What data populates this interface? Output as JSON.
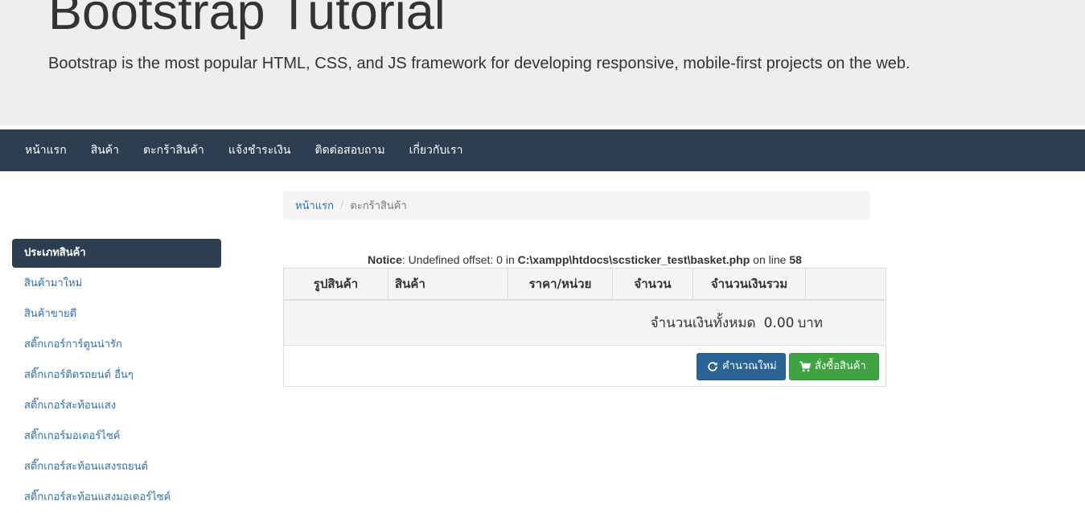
{
  "jumbotron": {
    "title": "Bootstrap Tutorial",
    "lead": "Bootstrap is the most popular HTML, CSS, and JS framework for developing responsive, mobile-first projects on the web."
  },
  "navbar": {
    "items": [
      "หน้าแรก",
      "สินค้า",
      "ตะกร้าสินค้า",
      "แจ้งชำระเงิน",
      "ติดต่อสอบถาม",
      "เกี่ยวกับเรา"
    ]
  },
  "breadcrumb": {
    "home": "หน้าแรก",
    "separator": "/",
    "current": "ตะกร้าสินค้า"
  },
  "sidebar": {
    "header": "ประเภทสินค้า",
    "items": [
      "สินค้ามาใหม่",
      "สินค้าขายดี",
      "สติ๊กเกอร์การ์ตูนน่ารัก",
      "สติ๊กเกอร์ติดรถยนต์ อื่นๆ",
      "สติ๊กเกอร์สะท้อนแสง",
      "สติ๊กเกอร์มอเตอร์ไซค์",
      "สติ๊กเกอร์สะท้อนแสงรถยนต์",
      "สติ๊กเกอร์สะท้อนแสงมอเตอร์ไซค์"
    ]
  },
  "notice": {
    "label": "Notice",
    "message_a": ": Undefined offset: 0 in ",
    "path": "C:\\xampp\\htdocs\\scsticker_test\\basket.php",
    "message_b": " on line ",
    "line": "58"
  },
  "cart": {
    "columns": [
      "รูปสินค้า",
      "สินค้า",
      "ราคา/หน่วย",
      "จำนวน",
      "จำนวนเงินรวม",
      ""
    ],
    "total_label": "จำนวนเงินทั้งหมด",
    "total_amount": "0.00",
    "currency": "บาท",
    "recalc_label": "คำนวณใหม่",
    "order_label": "สั่งซื้อสินค้า"
  },
  "icons": {
    "recalc": "refresh-icon",
    "order": "shopping-cart-icon"
  },
  "colors": {
    "navbar": "#2c3e50",
    "jumbotron": "#eeeeee",
    "link": "#2c6fb0",
    "primary_button": "#2a6496",
    "success_button": "#3fa33f"
  }
}
